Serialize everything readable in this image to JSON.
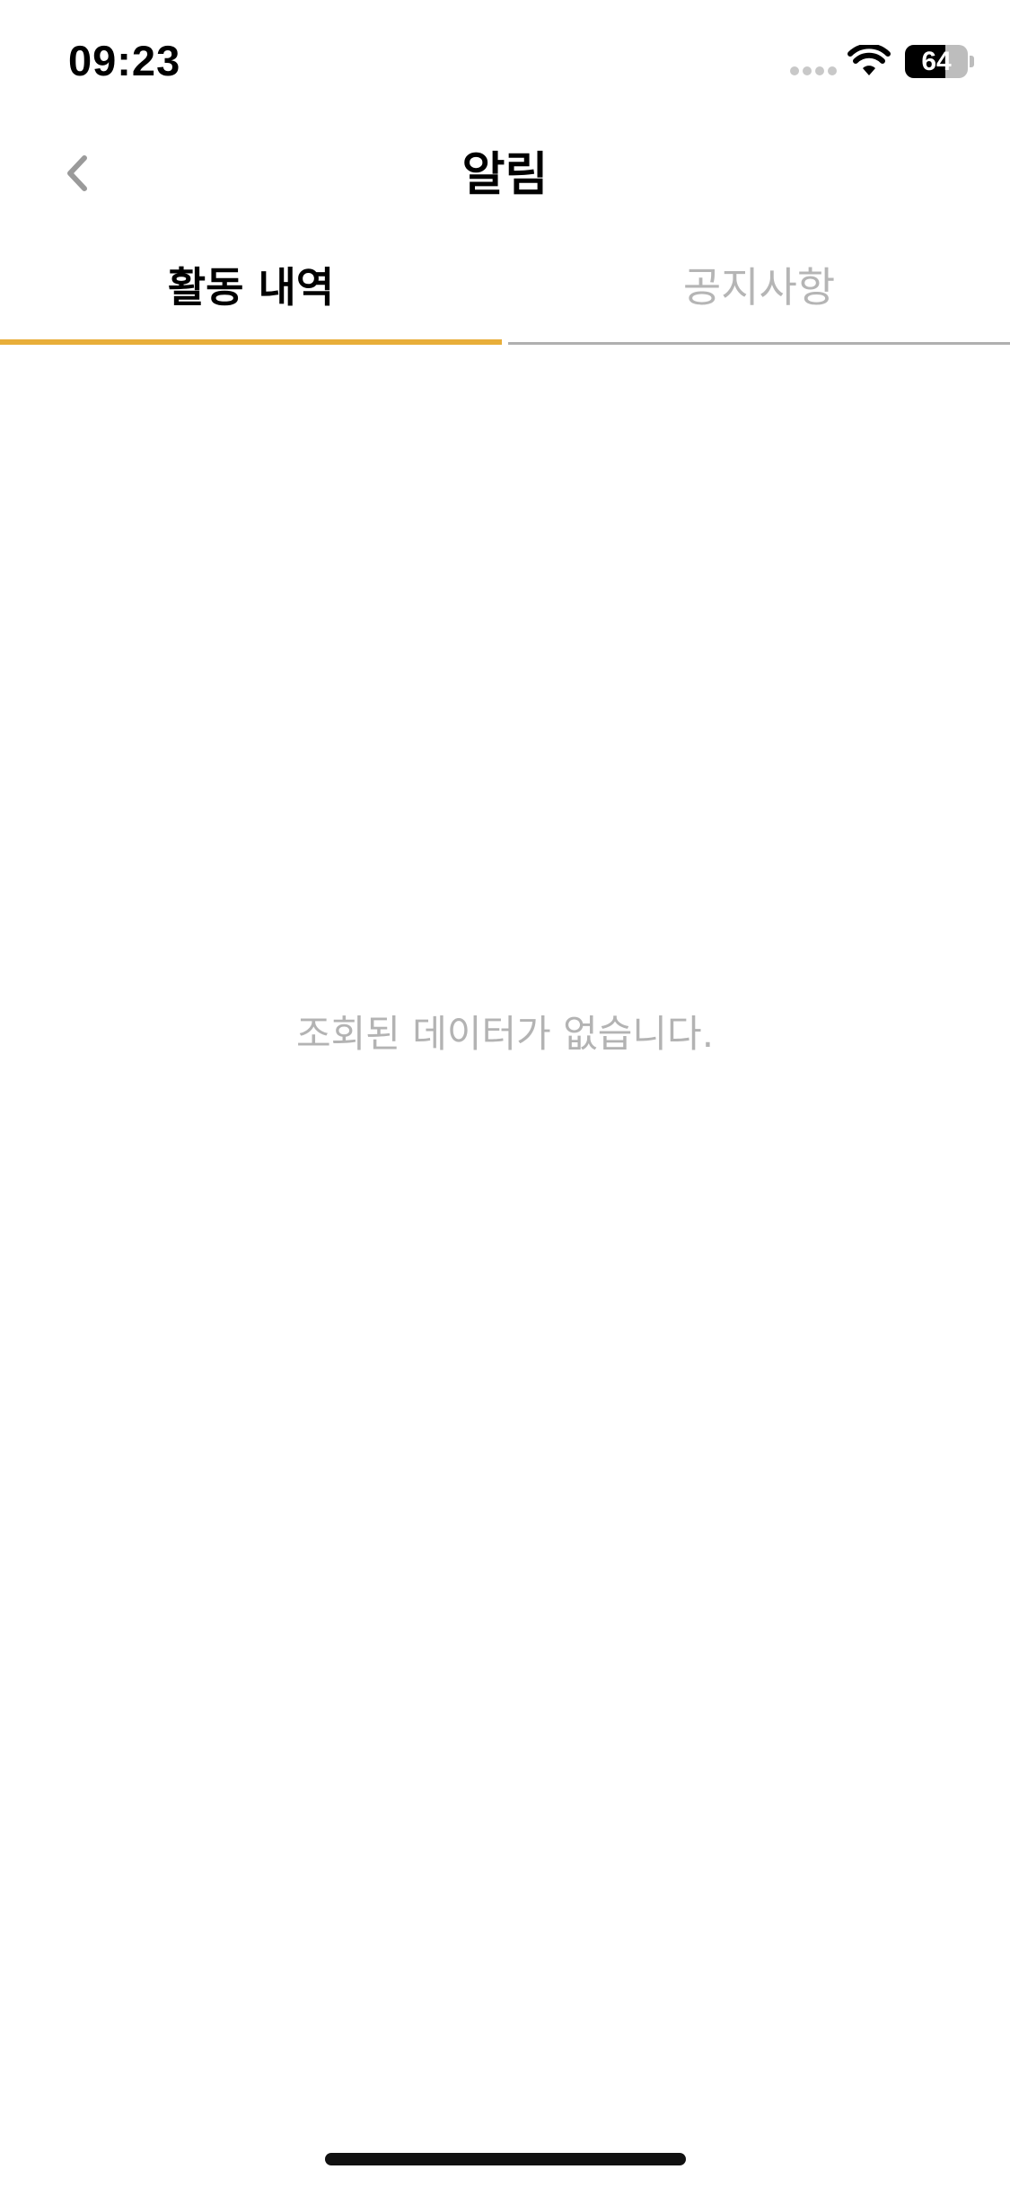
{
  "status_bar": {
    "time": "09:23",
    "battery_level": "64",
    "battery_fraction": 0.64
  },
  "nav": {
    "title": "알림",
    "back_icon": "chevron-left-icon"
  },
  "tabs": [
    {
      "label": "활동 내역",
      "active": true
    },
    {
      "label": "공지사항",
      "active": false
    }
  ],
  "content": {
    "empty_message": "조회된 데이터가 없습니다."
  },
  "colors": {
    "accent": "#E8AE3A",
    "inactive_text": "#B5B5B5",
    "inactive_line": "#B0B0B0"
  }
}
